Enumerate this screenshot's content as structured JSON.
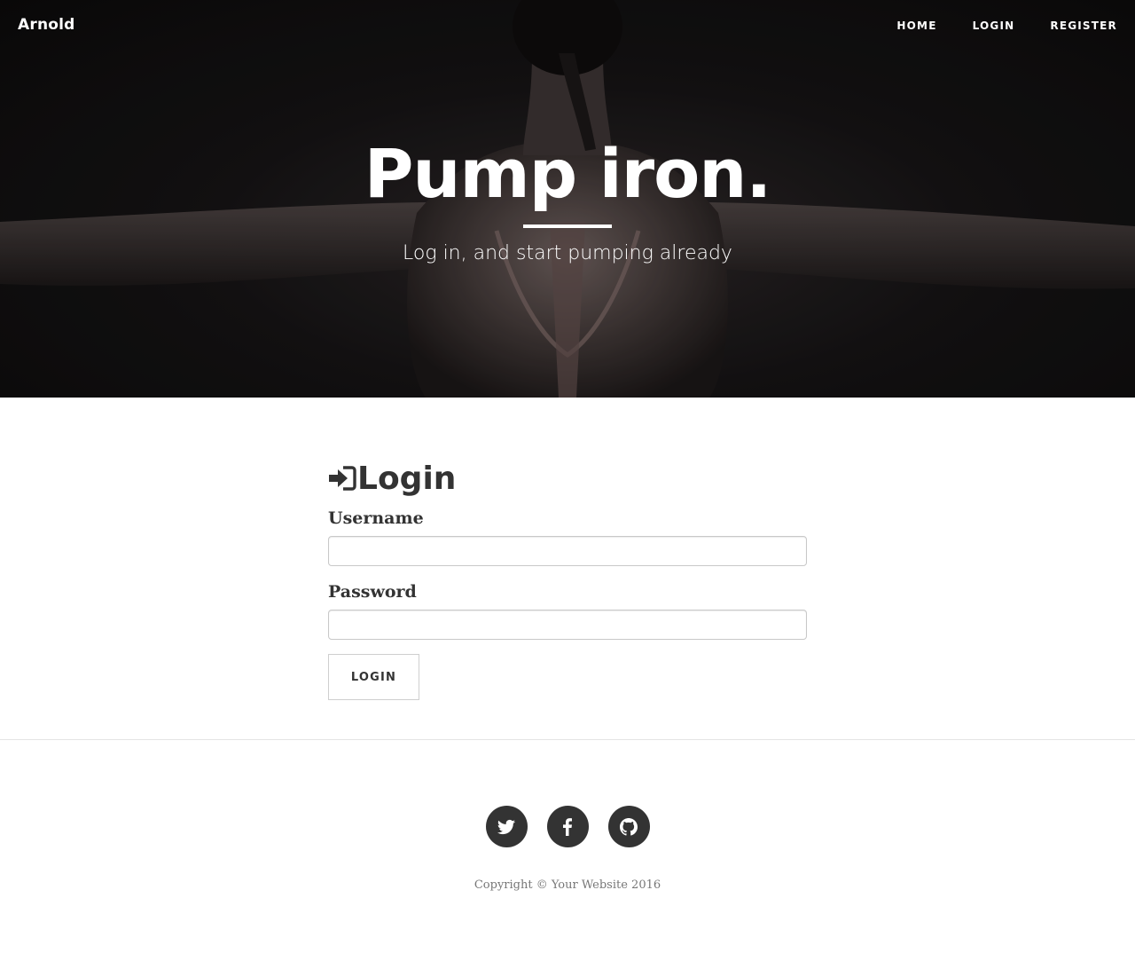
{
  "navbar": {
    "brand": "Arnold",
    "links": [
      {
        "label": "HOME"
      },
      {
        "label": "LOGIN"
      },
      {
        "label": "REGISTER"
      }
    ]
  },
  "hero": {
    "title": "Pump iron.",
    "subtitle": "Log in, and start pumping already"
  },
  "login": {
    "heading": "Login",
    "heading_icon": "sign-in-icon",
    "username_label": "Username",
    "username_value": "",
    "password_label": "Password",
    "password_value": "",
    "submit_label": "LOGIN"
  },
  "footer": {
    "socials": [
      {
        "icon": "twitter-icon"
      },
      {
        "icon": "facebook-icon"
      },
      {
        "icon": "github-icon"
      }
    ],
    "copyright": "Copyright © Your Website 2016"
  },
  "colors": {
    "text": "#333333",
    "hero_text": "#ffffff",
    "footer_text": "#777777",
    "social_bg": "#333333"
  }
}
